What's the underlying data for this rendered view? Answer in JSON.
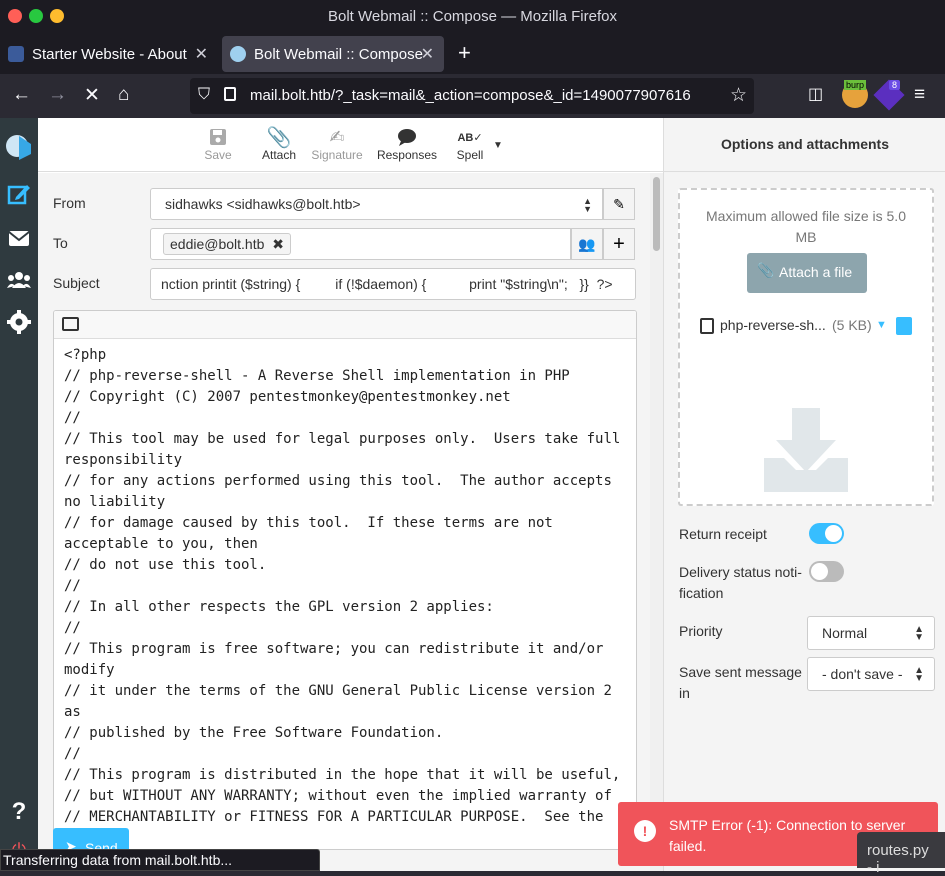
{
  "window": {
    "title": "Bolt Webmail :: Compose — Mozilla Firefox"
  },
  "tabs": [
    {
      "label": "Starter Website - About",
      "active": false
    },
    {
      "label": "Bolt Webmail :: Compose",
      "active": true
    }
  ],
  "url": {
    "address": "mail.bolt.htb/?_task=mail&_action=compose&_id=1490077907616"
  },
  "extensions": {
    "burp_label": "burp",
    "badge_count": "8"
  },
  "toolbar": {
    "save": "Save",
    "attach": "Attach",
    "signature": "Signature",
    "responses": "Responses",
    "spell": "Spell"
  },
  "compose": {
    "from_label": "From",
    "from_value": "sidhawks <sidhawks@bolt.htb>",
    "to_label": "To",
    "to_recipient": "eddie@bolt.htb",
    "subject_label": "Subject",
    "subject_value": "nction printit ($string) {         if (!$daemon) {           print \"$string\\n\";   }}  ?>",
    "body": "<?php\n// php-reverse-shell - A Reverse Shell implementation in PHP\n// Copyright (C) 2007 pentestmonkey@pentestmonkey.net\n//\n// This tool may be used for legal purposes only.  Users take full responsibility\n// for any actions performed using this tool.  The author accepts no liability\n// for damage caused by this tool.  If these terms are not acceptable to you, then\n// do not use this tool.\n//\n// In all other respects the GPL version 2 applies:\n//\n// This program is free software; you can redistribute it and/or modify\n// it under the terms of the GNU General Public License version 2 as\n// published by the Free Software Foundation.\n//\n// This program is distributed in the hope that it will be useful,\n// but WITHOUT ANY WARRANTY; without even the implied warranty of\n// MERCHANTABILITY or FITNESS FOR A PARTICULAR PURPOSE.  See the",
    "send": "Send"
  },
  "options": {
    "title": "Options and attachments",
    "max_size": "Maximum allowed file size is 5.0 MB",
    "attach_button": "Attach a file",
    "file_name": "php-reverse-sh...",
    "file_size": "(5 KB)",
    "return_receipt": "Return receipt",
    "return_receipt_on": true,
    "delivery_status": "Delivery status noti-fication",
    "delivery_status_on": false,
    "priority_label": "Priority",
    "priority_value": "Normal",
    "save_sent_label": "Save sent message in",
    "save_sent_value": "- don't save -"
  },
  "status": {
    "text": "Transferring data from mail.bolt.htb..."
  },
  "error": {
    "text": "SMTP Error (-1): Connection to server failed."
  },
  "taskbar": {
    "label": "routes.py - i"
  },
  "colors": {
    "accent": "#37beff",
    "sidebar": "#2f3a3f",
    "error": "#f0545a"
  }
}
